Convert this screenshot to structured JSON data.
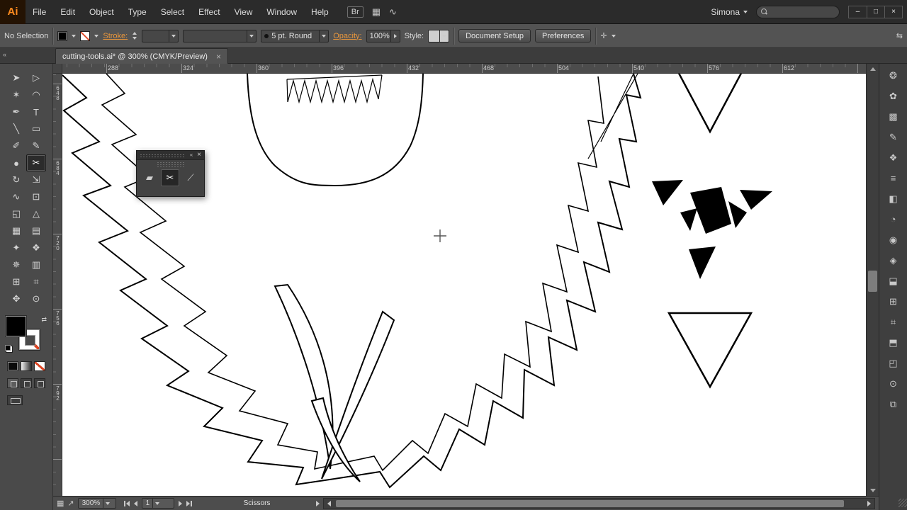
{
  "menubar": {
    "logo": "Ai",
    "menus": [
      "File",
      "Edit",
      "Object",
      "Type",
      "Select",
      "Effect",
      "View",
      "Window",
      "Help"
    ],
    "bridge": "Br",
    "arrange_icon": "▦",
    "share_icon": "∿",
    "workspace": "Simona",
    "window": {
      "minimize": "–",
      "restore": "□",
      "close": "×"
    }
  },
  "controlbar": {
    "selection_status": "No Selection",
    "stroke_label": "Stroke:",
    "brush_value": "5 pt. Round",
    "opacity_label": "Opacity:",
    "opacity_value": "100%",
    "style_label": "Style:",
    "document_setup": "Document Setup",
    "preferences": "Preferences",
    "snap_icon": "✛",
    "panel_icon": "⇆"
  },
  "tabbar": {
    "collapse": "«",
    "title": "cutting-tools.ai* @ 300% (CMYK/Preview)",
    "close": "×"
  },
  "toolbar": {
    "tools": [
      {
        "name": "selection-tool",
        "glyph": "➤"
      },
      {
        "name": "direct-selection-tool",
        "glyph": "▷"
      },
      {
        "name": "magic-wand-tool",
        "glyph": "✶"
      },
      {
        "name": "lasso-tool",
        "glyph": "◠"
      },
      {
        "name": "pen-tool",
        "glyph": "✒"
      },
      {
        "name": "type-tool",
        "glyph": "T"
      },
      {
        "name": "line-segment-tool",
        "glyph": "╲"
      },
      {
        "name": "rectangle-tool",
        "glyph": "▭"
      },
      {
        "name": "paintbrush-tool",
        "glyph": "✐"
      },
      {
        "name": "pencil-tool",
        "glyph": "✎"
      },
      {
        "name": "blob-brush-tool",
        "glyph": "●"
      },
      {
        "name": "scissors-tool",
        "glyph": "✂",
        "selected": true
      },
      {
        "name": "rotate-tool",
        "glyph": "↻"
      },
      {
        "name": "scale-tool",
        "glyph": "⇲"
      },
      {
        "name": "width-tool",
        "glyph": "∿"
      },
      {
        "name": "free-transform-tool",
        "glyph": "⊡"
      },
      {
        "name": "shape-builder-tool",
        "glyph": "◱"
      },
      {
        "name": "perspective-grid-tool",
        "glyph": "△"
      },
      {
        "name": "mesh-tool",
        "glyph": "▦"
      },
      {
        "name": "gradient-tool",
        "glyph": "▤"
      },
      {
        "name": "eyedropper-tool",
        "glyph": "✦"
      },
      {
        "name": "blend-tool",
        "glyph": "❖"
      },
      {
        "name": "symbol-sprayer-tool",
        "glyph": "✵"
      },
      {
        "name": "column-graph-tool",
        "glyph": "▥"
      },
      {
        "name": "artboard-tool",
        "glyph": "⊞"
      },
      {
        "name": "slice-tool",
        "glyph": "⌗"
      },
      {
        "name": "hand-tool",
        "glyph": "✥"
      },
      {
        "name": "zoom-tool",
        "glyph": "⊙"
      }
    ]
  },
  "fillstroke": {
    "swap_icon": "⇄"
  },
  "floating_panel": {
    "collapse": "«",
    "close": "×",
    "tools": [
      {
        "name": "eraser-tool",
        "glyph": "▰",
        "selected": false
      },
      {
        "name": "scissors-tool",
        "glyph": "✂",
        "selected": true
      },
      {
        "name": "knife-tool",
        "glyph": "⟋",
        "selected": false
      }
    ]
  },
  "rulers": {
    "horizontal": [
      "288",
      "324",
      "360",
      "396",
      "432",
      "468",
      "504",
      "540",
      "576",
      "612"
    ],
    "vertical": [
      "648",
      "684",
      "720",
      "756",
      "792"
    ]
  },
  "right_dock": {
    "icons": [
      {
        "name": "panel-color",
        "glyph": "❂"
      },
      {
        "name": "panel-color-guide",
        "glyph": "✿"
      },
      {
        "name": "panel-swatches",
        "glyph": "▩"
      },
      {
        "name": "panel-brushes",
        "glyph": "✎"
      },
      {
        "name": "panel-symbols",
        "glyph": "❖"
      },
      {
        "name": "panel-stroke",
        "glyph": "≡"
      },
      {
        "name": "panel-gradient",
        "glyph": "◧"
      },
      {
        "name": "panel-transparency",
        "glyph": "◔"
      },
      {
        "name": "panel-appearance",
        "glyph": "◉"
      },
      {
        "name": "panel-graphic-styles",
        "glyph": "◈"
      },
      {
        "name": "panel-layers",
        "glyph": "⬓"
      },
      {
        "name": "panel-artboards",
        "glyph": "⊞"
      },
      {
        "name": "panel-align",
        "glyph": "⌗"
      },
      {
        "name": "panel-transform",
        "glyph": "⬒"
      },
      {
        "name": "panel-pathfinder",
        "glyph": "◰"
      },
      {
        "name": "panel-navigator",
        "glyph": "⊙"
      },
      {
        "name": "panel-links",
        "glyph": "⧉"
      }
    ]
  },
  "statusbar": {
    "left_icon1": "▦",
    "left_icon2": "↗",
    "zoom": "300%",
    "artboard": "1",
    "status": "Scissors"
  }
}
